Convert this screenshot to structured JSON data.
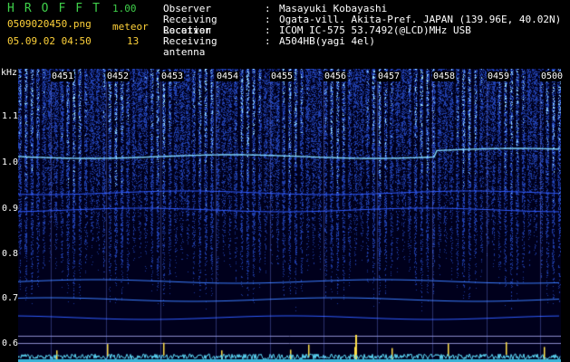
{
  "header": {
    "logo": "HROFFT",
    "version": "1.00",
    "filename": "050902045​0.png",
    "datetime": "05.09.02 04:50",
    "meteor_label": "meteor",
    "meteor_count": "13"
  },
  "info": [
    {
      "key": "Observer",
      "value": "Masayuki Kobayashi"
    },
    {
      "key": "Receiving Location",
      "value": "Ogata-vill. Akita-Pref. JAPAN (139.96E, 40.02N)"
    },
    {
      "key": "Receiver",
      "value": "ICOM IC-575 53.7492(@LCD)MHz USB"
    },
    {
      "key": "Receiving antenna",
      "value": "A504HB(yagi 4el)"
    }
  ],
  "spectrogram": {
    "unit": "kHz",
    "y_ticks": [
      "1.1",
      "1.0",
      "0.9",
      "0.8",
      "0.7",
      "0.6"
    ],
    "time_ticks": [
      "0451",
      "0452",
      "0453",
      "0454",
      "0455",
      "0456",
      "0457",
      "0458",
      "0459",
      "0500"
    ],
    "colors": {
      "background": "#00001c",
      "signal": "#2f5bff",
      "hot": "#9fe8ff",
      "carrier": "#7fd6ff",
      "trace": "#5fe0ff",
      "meteor": "#ffe04a"
    }
  }
}
